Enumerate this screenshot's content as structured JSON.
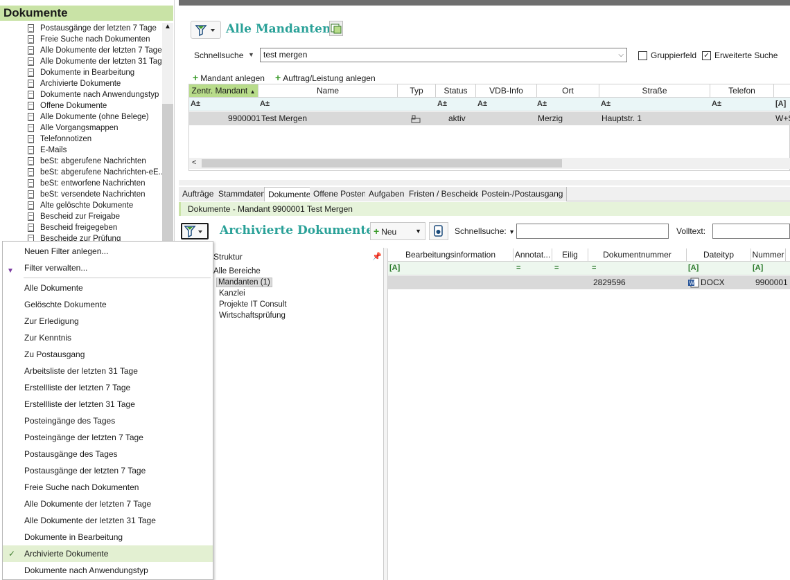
{
  "sidebar": {
    "title": "Dokumente",
    "items": [
      "Postausgänge der letzten 7 Tage",
      "Freie Suche nach Dokumenten",
      "Alle Dokumente der letzten 7 Tage",
      "Alle Dokumente der letzten 31 Tage",
      "Dokumente in Bearbeitung",
      "Archivierte Dokumente",
      "Dokumente nach Anwendungstyp",
      "Offene Dokumente",
      "Alle Dokumente (ohne Belege)",
      "Alle Vorgangsmappen",
      "Telefonnotizen",
      "E-Mails",
      "beSt: abgerufene Nachrichten",
      "beSt: abgerufene Nachrichten-eE...",
      "beSt: entworfene Nachrichten",
      "beSt: versendete Nachrichten",
      "Alte gelöschte Dokumente",
      "Bescheid zur Freigabe",
      "Bescheid freigegeben",
      "Bescheide zur Prüfung"
    ]
  },
  "mandanten": {
    "title": "Alle Mandanten",
    "quicksearch_label": "Schnellsuche",
    "quicksearch_value": "test mergen",
    "group_field_label": "Gruppierfeld",
    "extended_search_label": "Erweiterte Suche",
    "group_field_checked": false,
    "extended_search_checked": true,
    "add_mandant": "Mandant anlegen",
    "add_auftrag": "Auftrag/Leistung anlegen",
    "columns": [
      "Zentr. Mandant",
      "Name",
      "Typ",
      "Status",
      "VDB-Info",
      "Ort",
      "Straße",
      "Telefon",
      ""
    ],
    "row": {
      "nr": "9900001",
      "name": "Test Mergen",
      "status": "aktiv",
      "ort": "Merzig",
      "strasse": "Hauptstr. 1",
      "telefon": "W+S"
    }
  },
  "bottom_tabs": [
    "Aufträge",
    "Stammdaten",
    "Dokumente",
    "Offene Posten",
    "Aufgaben",
    "Fristen / Bescheide",
    "Postein-/Postausgang"
  ],
  "breadcrumb": "Dokumente - Mandant 9900001 Test Mergen",
  "archive": {
    "title": "Archivierte Dokumente",
    "new_label": "Neu",
    "quicksearch_label": "Schnellsuche:",
    "fulltext_label": "Volltext:",
    "structure_header": "Struktur",
    "tree": [
      "Alle Bereiche",
      "Mandanten (1)",
      "Kanzlei",
      "Projekte IT Consult",
      "Wirtschaftsprüfung"
    ],
    "columns": [
      "Bearbeitungsinformation",
      "Annotat...",
      "Eilig",
      "Dokumentnummer",
      "Dateityp",
      "Nummer"
    ],
    "row": {
      "docnr": "2829596",
      "dateityp": "DOCX",
      "nummer": "9900001"
    }
  },
  "menu": {
    "top": [
      "Neuen Filter anlegen...",
      "Filter verwalten..."
    ],
    "items": [
      "Alle Dokumente",
      "Gelöschte Dokumente",
      "Zur Erledigung",
      "Zur Kenntnis",
      "Zu Postausgang",
      "Arbeitsliste der letzten 31 Tage",
      "Erstellliste der letzten 7 Tage",
      "Erstellliste der letzten 31 Tage",
      "Posteingänge des Tages",
      "Posteingänge der letzten 7 Tage",
      "Postausgänge des Tages",
      "Postausgänge der letzten 7 Tage",
      "Freie Suche nach Dokumenten",
      "Alle Dokumente der letzten 7 Tage",
      "Alle Dokumente der letzten 31 Tage",
      "Dokumente in Bearbeitung",
      "Archivierte Dokumente",
      "Dokumente nach Anwendungstyp"
    ],
    "checked_item": "Archivierte Dokumente"
  },
  "colors": {
    "accent_green": "#c9e3a6",
    "title_teal": "#2aa198",
    "header_dark": "#6e6e6e"
  },
  "icons": {
    "filter": "filter-icon",
    "document": "document-icon",
    "word": "word-file-icon",
    "check": "checkmark-icon"
  }
}
